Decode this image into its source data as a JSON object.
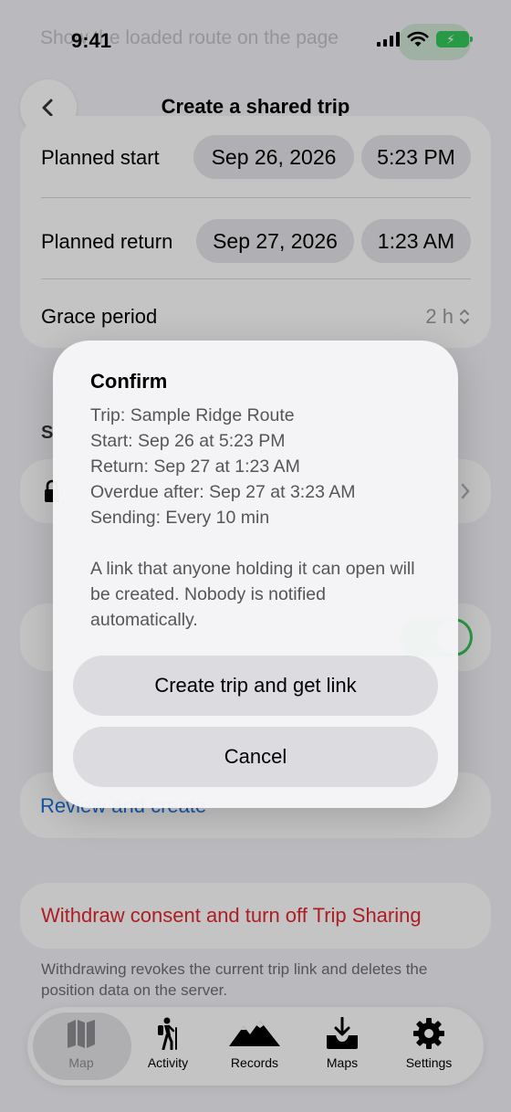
{
  "status": {
    "time": "9:41"
  },
  "ghost_row": {
    "label": "Show the loaded route on the page"
  },
  "nav": {
    "title": "Create a shared trip"
  },
  "schedule": {
    "start_label": "Planned start",
    "start_date": "Sep 26, 2026",
    "start_time": "5:23 PM",
    "return_label": "Planned return",
    "return_date": "Sep 27, 2026",
    "return_time": "1:23 AM",
    "grace_label": "Grace period",
    "grace_value": "2 h"
  },
  "dialog": {
    "title": "Confirm",
    "lines": [
      "Trip: Sample Ridge Route",
      "Start: Sep 26 at 5:23 PM",
      "Return: Sep 27 at 1:23 AM",
      "Overdue after: Sep 27 at 3:23 AM",
      "Sending: Every 10 min"
    ],
    "message": "A link that anyone holding it can open will be created. Nobody is notified automatically.",
    "primary_label": "Create trip and get link",
    "cancel_label": "Cancel"
  },
  "review": {
    "label": "Review and create"
  },
  "withdraw": {
    "label": "Withdraw consent and turn off Trip Sharing",
    "note": "Withdrawing revokes the current trip link and deletes the position data on the server."
  },
  "tabs": [
    {
      "label": "Map",
      "icon": "map-icon",
      "active": true
    },
    {
      "label": "Activity",
      "icon": "hiker-icon",
      "active": false
    },
    {
      "label": "Records",
      "icon": "mountains-icon",
      "active": false
    },
    {
      "label": "Maps",
      "icon": "tray-download-icon",
      "active": false
    },
    {
      "label": "Settings",
      "icon": "gear-icon",
      "active": false
    }
  ],
  "colors": {
    "accent_blue": "#1e6fd6",
    "destructive_red": "#e0282e",
    "toggle_green": "#34c759"
  }
}
